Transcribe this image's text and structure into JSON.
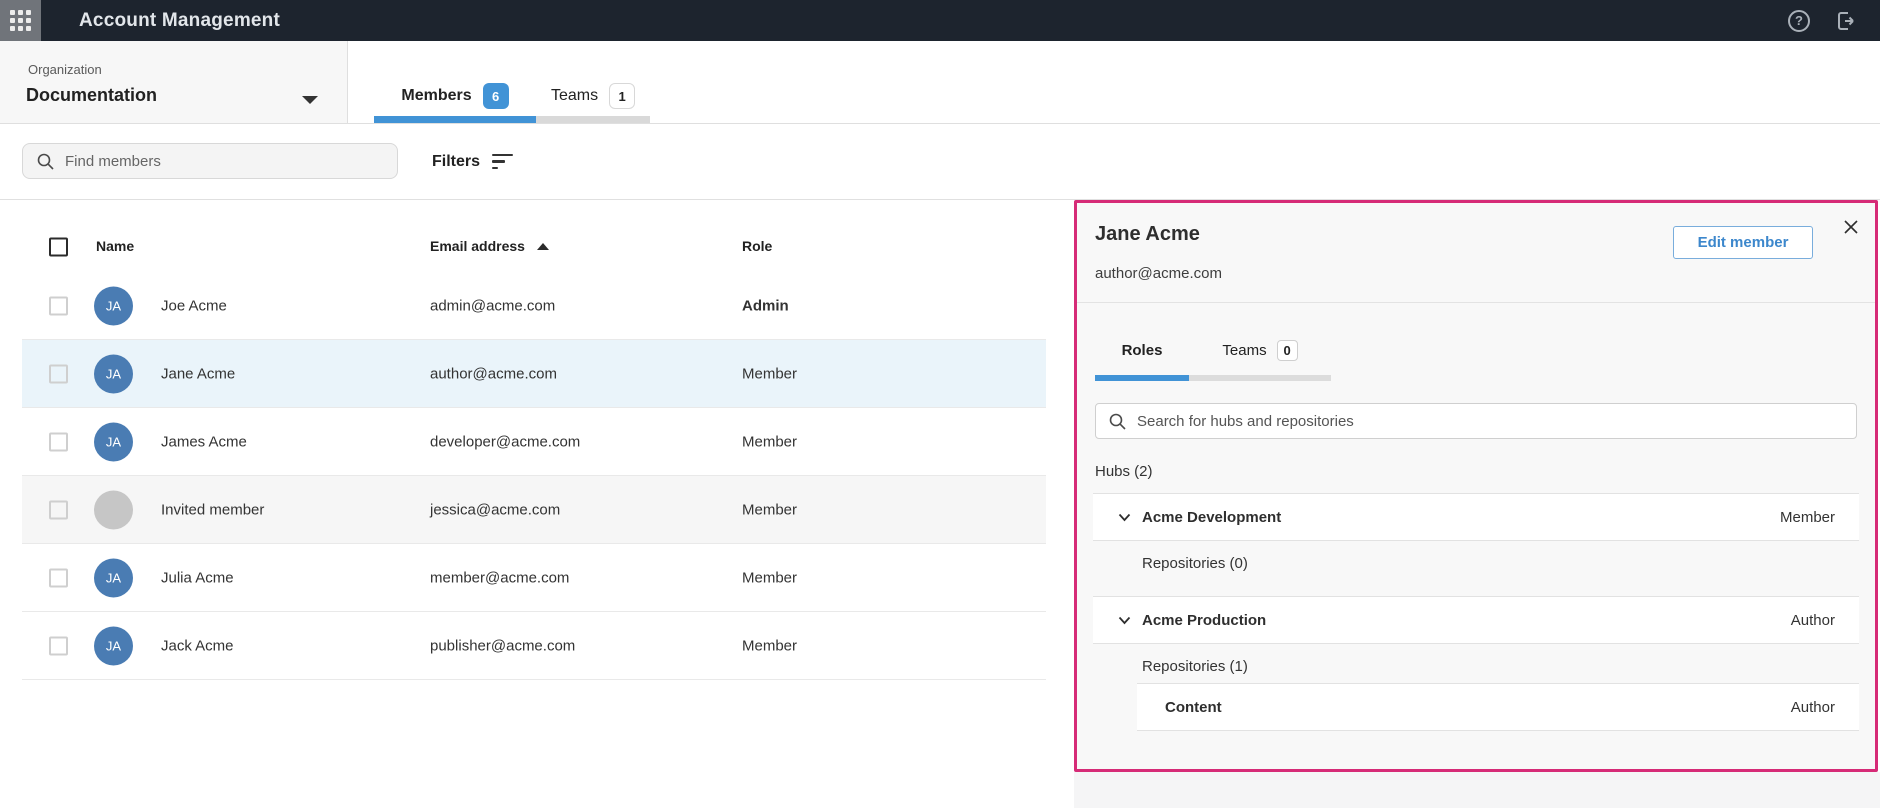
{
  "colors": {
    "topbar_bg": "#1D242E",
    "accent_blue": "#4193D6",
    "avatar_blue": "#4A7CB3",
    "panel_border_pink": "#D62B77",
    "selected_row_bg": "#EAF4FA",
    "pending_row_bg": "#F6F6F6"
  },
  "topbar": {
    "title": "Account Management",
    "help_glyph": "?"
  },
  "org_selector": {
    "label": "Organization",
    "value": "Documentation"
  },
  "main_tabs": [
    {
      "label": "Members",
      "badge": "6",
      "active": true
    },
    {
      "label": "Teams",
      "badge": "1",
      "active": false
    }
  ],
  "toolbar": {
    "search_placeholder": "Find members",
    "filters_label": "Filters"
  },
  "members_table": {
    "headers": {
      "name": "Name",
      "email": "Email address",
      "role": "Role"
    },
    "sort": {
      "column": "Email address",
      "direction": "ascending"
    },
    "rows": [
      {
        "initials": "JA",
        "name": "Joe Acme",
        "email": "admin@acme.com",
        "role": "Admin",
        "state": "normal"
      },
      {
        "initials": "JA",
        "name": "Jane Acme",
        "email": "author@acme.com",
        "role": "Member",
        "state": "selected"
      },
      {
        "initials": "JA",
        "name": "James Acme",
        "email": "developer@acme.com",
        "role": "Member",
        "state": "normal"
      },
      {
        "initials": "",
        "name": "Invited member",
        "email": "jessica@acme.com",
        "role": "Member",
        "state": "pending"
      },
      {
        "initials": "JA",
        "name": "Julia Acme",
        "email": "member@acme.com",
        "role": "Member",
        "state": "normal"
      },
      {
        "initials": "JA",
        "name": "Jack Acme",
        "email": "publisher@acme.com",
        "role": "Member",
        "state": "normal"
      }
    ]
  },
  "detail_panel": {
    "title": "Jane Acme",
    "email": "author@acme.com",
    "edit_button_label": "Edit member",
    "tabs": [
      {
        "label": "Roles",
        "active": true
      },
      {
        "label": "Teams",
        "badge": "0",
        "active": false
      }
    ],
    "search_placeholder": "Search for hubs and repositories",
    "hubs_heading": "Hubs (2)",
    "hubs": [
      {
        "name": "Acme Development",
        "role": "Member",
        "repositories_label": "Repositories (0)",
        "repositories": []
      },
      {
        "name": "Acme Production",
        "role": "Author",
        "repositories_label": "Repositories (1)",
        "repositories": [
          {
            "name": "Content",
            "role": "Author"
          }
        ]
      }
    ]
  }
}
